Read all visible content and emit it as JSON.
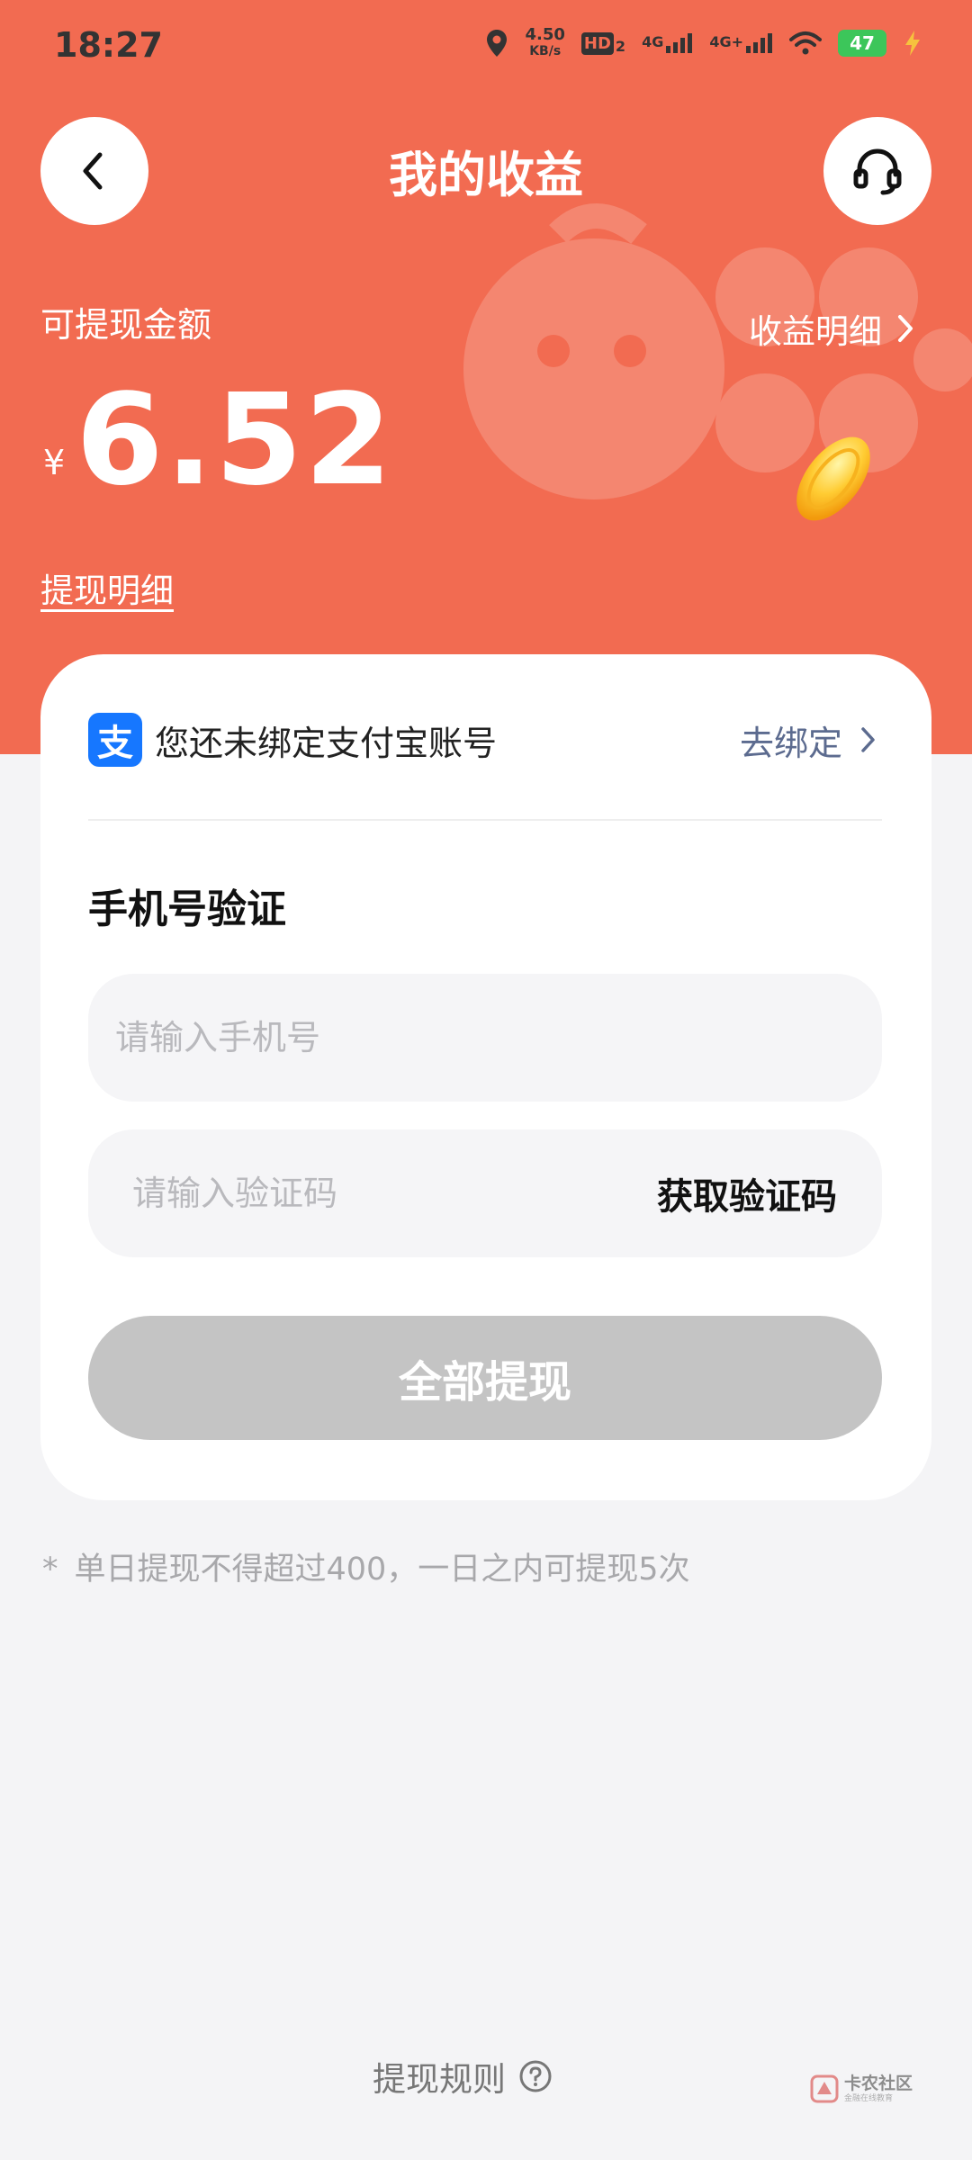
{
  "status_bar": {
    "time": "18:27",
    "net_speed_value": "4.50",
    "net_speed_unit": "KB/s",
    "hd_label": "HD",
    "hd_sub": "2",
    "sim1_label": "4G",
    "sim2_label": "4G+",
    "battery_level": "47",
    "icons": [
      "location-icon",
      "signal-icon",
      "wifi-icon",
      "battery-icon",
      "charging-icon"
    ]
  },
  "header": {
    "title": "我的收益",
    "back_icon": "chevron-left-icon",
    "service_icon": "headset-icon"
  },
  "earnings": {
    "available_label": "可提现金额",
    "details_link": "收益明细",
    "currency_symbol": "¥",
    "amount": "6.52",
    "withdraw_details_link": "提现明细"
  },
  "card": {
    "alipay_icon_char": "支",
    "alipay_notice": "您还未绑定支付宝账号",
    "bind_link": "去绑定",
    "section_title": "手机号验证",
    "phone_placeholder": "请输入手机号",
    "phone_value": "",
    "code_placeholder": "请输入验证码",
    "code_value": "",
    "get_code_label": "获取验证码",
    "withdraw_button": "全部提现"
  },
  "note": {
    "star": "*",
    "text": "单日提现不得超过400，一日之内可提现5次"
  },
  "footer": {
    "rules_link": "提现规则",
    "help_icon": "question-circle-icon",
    "corner_logo_main": "卡农社区",
    "corner_logo_sub": "金融在线教育"
  },
  "colors": {
    "header_bg": "#f26b51",
    "page_bg": "#f4f4f6",
    "alipay_blue": "#1677ff",
    "bind_link": "#5c6b8f",
    "disabled_button": "#c4c4c4",
    "battery_green": "#3cc65a"
  }
}
